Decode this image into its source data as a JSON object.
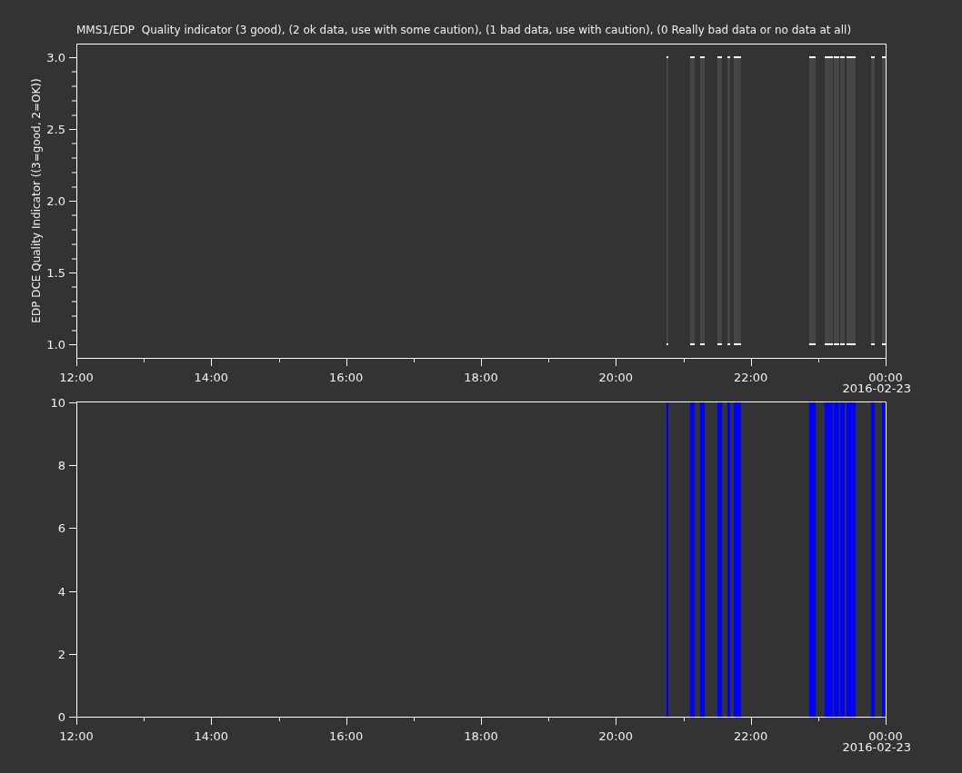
{
  "title": "MMS1/EDP  Quality indicator (3 good), (2 ok data, use with some caution), (1 bad data, use with caution), (0 Really bad data or no data at all)",
  "panels": [
    {
      "kind": "quality",
      "ylabel": "EDP DCE Quality Indicator ((3=good, 2=OK))",
      "yticks": [
        "3.0",
        "2.5",
        "2.0",
        "1.5",
        "1.0"
      ],
      "xticks": [
        "12:00",
        "14:00",
        "16:00",
        "18:00",
        "20:00",
        "22:00",
        "00:00"
      ],
      "date_label": "2016-02-23"
    },
    {
      "kind": "count",
      "yticks": [
        "10",
        "8",
        "6",
        "4",
        "2",
        "0"
      ],
      "xticks": [
        "12:00",
        "14:00",
        "16:00",
        "18:00",
        "20:00",
        "22:00",
        "00:00"
      ],
      "date_label": "2016-02-23"
    }
  ]
}
